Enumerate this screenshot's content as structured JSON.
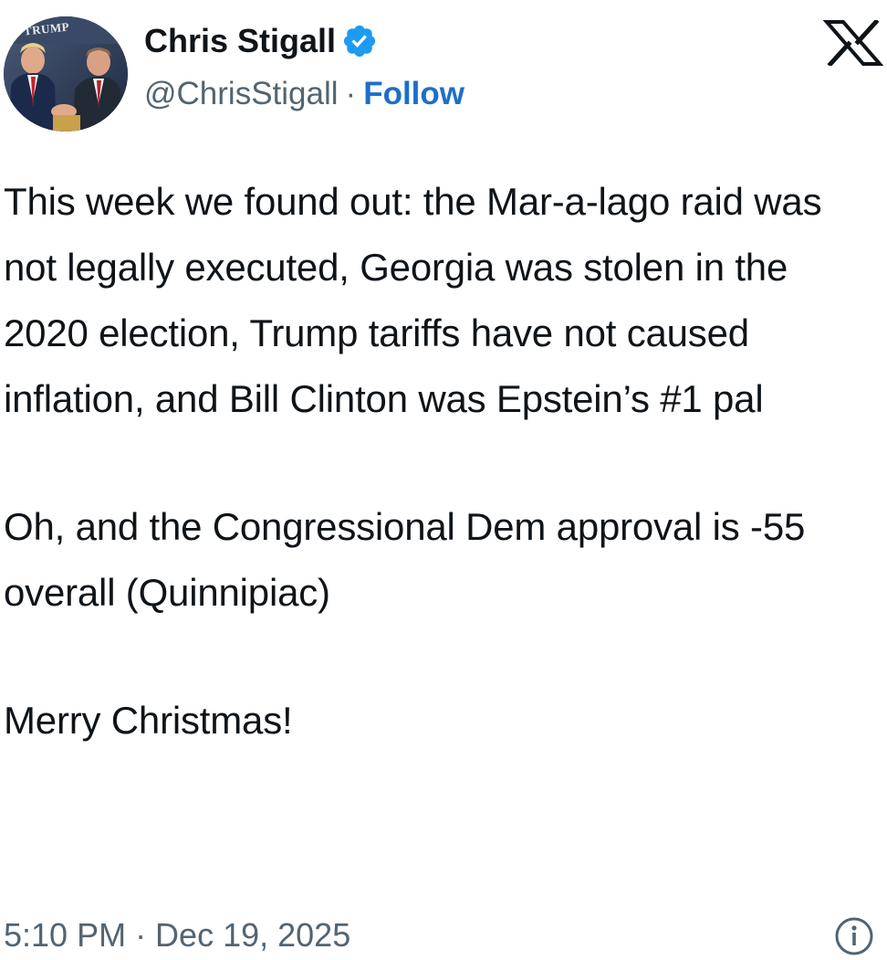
{
  "author": {
    "display_name": "Chris Stigall",
    "handle": "@ChrisStigall",
    "separator": "·",
    "follow_label": "Follow",
    "verified_icon": "verified-badge-icon",
    "avatar_logo_text": "TRUMP"
  },
  "platform_logo": "x-logo-icon",
  "tweet": {
    "paragraph_1": "This week we found out: the Mar-a-lago raid was not legally executed, Georgia was stolen in the 2020 election, Trump tariffs have not caused inflation, and Bill Clinton was Epstein’s #1 pal",
    "paragraph_2": "Oh, and the Congressional Dem approval is -55 overall (Quinnipiac)",
    "paragraph_3": "Merry Christmas!"
  },
  "footer": {
    "timestamp": "5:10 PM · Dec 19, 2025",
    "info_icon": "info-icon"
  },
  "colors": {
    "text": "#0f1419",
    "muted": "#536471",
    "link": "#1d6fc9",
    "verified": "#1d9bf0"
  }
}
